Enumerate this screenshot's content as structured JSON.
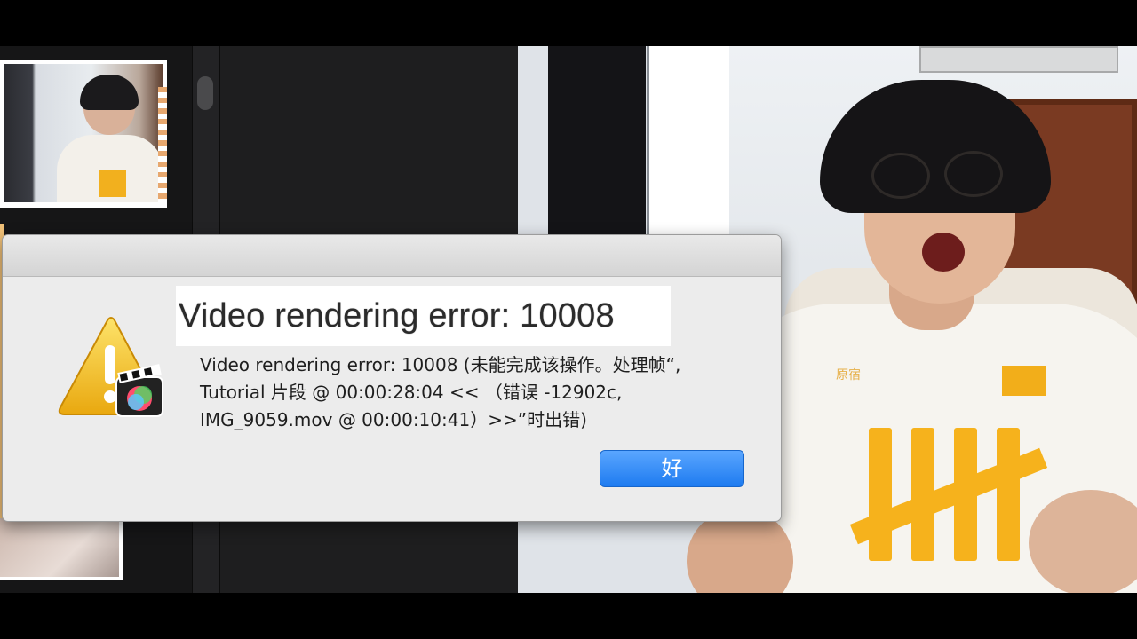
{
  "dialog": {
    "heading": "Video rendering error: 10008",
    "message": "Video rendering error: 10008 (未能完成该操作。处理帧“,\nTutorial 片段 @ 00:00:28:04 << （错误 -12902c,\nIMG_9059.mov @ 00:00:10:41）>>”时出错)",
    "ok_label": "好",
    "icon": "warning-icon",
    "app_icon": "final-cut-pro-icon"
  },
  "overlay": {
    "shirt_text": "原宿"
  },
  "colors": {
    "button_accent": "#1e7bf0",
    "warning_yellow": "#f6c21c",
    "shirt_logo": "#f6b21c"
  }
}
